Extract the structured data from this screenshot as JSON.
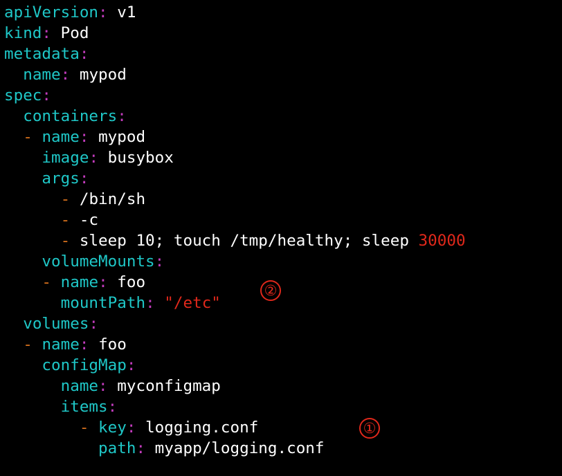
{
  "colors": {
    "background": "#000000",
    "key": "#1fc7c7",
    "punct": "#c23cbd",
    "dash": "#d6701c",
    "value": "#ffffff",
    "number": "#e0281b",
    "string": "#e0281b",
    "marker": "#e0281b"
  },
  "lines": [
    [
      {
        "t": "apiVersion",
        "c": "key"
      },
      {
        "t": ":",
        "c": "punct"
      },
      {
        "t": " v1",
        "c": "value"
      }
    ],
    [
      {
        "t": "kind",
        "c": "key"
      },
      {
        "t": ":",
        "c": "punct"
      },
      {
        "t": " Pod",
        "c": "value"
      }
    ],
    [
      {
        "t": "metadata",
        "c": "key"
      },
      {
        "t": ":",
        "c": "punct"
      }
    ],
    [
      {
        "t": "  "
      },
      {
        "t": "name",
        "c": "key"
      },
      {
        "t": ":",
        "c": "punct"
      },
      {
        "t": " mypod",
        "c": "value"
      }
    ],
    [
      {
        "t": "spec",
        "c": "key"
      },
      {
        "t": ":",
        "c": "punct"
      }
    ],
    [
      {
        "t": "  "
      },
      {
        "t": "containers",
        "c": "key"
      },
      {
        "t": ":",
        "c": "punct"
      }
    ],
    [
      {
        "t": "  "
      },
      {
        "t": "-",
        "c": "dash"
      },
      {
        "t": " "
      },
      {
        "t": "name",
        "c": "key"
      },
      {
        "t": ":",
        "c": "punct"
      },
      {
        "t": " mypod",
        "c": "value"
      }
    ],
    [
      {
        "t": "    "
      },
      {
        "t": "image",
        "c": "key"
      },
      {
        "t": ":",
        "c": "punct"
      },
      {
        "t": " busybox",
        "c": "value"
      }
    ],
    [
      {
        "t": "    "
      },
      {
        "t": "args",
        "c": "key"
      },
      {
        "t": ":",
        "c": "punct"
      }
    ],
    [
      {
        "t": "      "
      },
      {
        "t": "-",
        "c": "dash"
      },
      {
        "t": " /bin/sh",
        "c": "value"
      }
    ],
    [
      {
        "t": "      "
      },
      {
        "t": "-",
        "c": "dash"
      },
      {
        "t": " -c",
        "c": "value"
      }
    ],
    [
      {
        "t": "      "
      },
      {
        "t": "-",
        "c": "dash"
      },
      {
        "t": " sleep 10; touch /tmp/healthy; sleep ",
        "c": "value"
      },
      {
        "t": "30000",
        "c": "number"
      }
    ],
    [
      {
        "t": "    "
      },
      {
        "t": "volumeMounts",
        "c": "key"
      },
      {
        "t": ":",
        "c": "punct"
      }
    ],
    [
      {
        "t": "    "
      },
      {
        "t": "-",
        "c": "dash"
      },
      {
        "t": " "
      },
      {
        "t": "name",
        "c": "key"
      },
      {
        "t": ":",
        "c": "punct"
      },
      {
        "t": " foo",
        "c": "value"
      }
    ],
    [
      {
        "t": "      "
      },
      {
        "t": "mountPath",
        "c": "key"
      },
      {
        "t": ":",
        "c": "punct"
      },
      {
        "t": " "
      },
      {
        "t": "\"/etc\"",
        "c": "string"
      }
    ],
    [
      {
        "t": "  "
      },
      {
        "t": "volumes",
        "c": "key"
      },
      {
        "t": ":",
        "c": "punct"
      }
    ],
    [
      {
        "t": "  "
      },
      {
        "t": "-",
        "c": "dash"
      },
      {
        "t": " "
      },
      {
        "t": "name",
        "c": "key"
      },
      {
        "t": ":",
        "c": "punct"
      },
      {
        "t": " foo",
        "c": "value"
      }
    ],
    [
      {
        "t": "    "
      },
      {
        "t": "configMap",
        "c": "key"
      },
      {
        "t": ":",
        "c": "punct"
      }
    ],
    [
      {
        "t": "      "
      },
      {
        "t": "name",
        "c": "key"
      },
      {
        "t": ":",
        "c": "punct"
      },
      {
        "t": " myconfigmap",
        "c": "value"
      }
    ],
    [
      {
        "t": "      "
      },
      {
        "t": "items",
        "c": "key"
      },
      {
        "t": ":",
        "c": "punct"
      }
    ],
    [
      {
        "t": "        "
      },
      {
        "t": "-",
        "c": "dash"
      },
      {
        "t": " "
      },
      {
        "t": "key",
        "c": "key"
      },
      {
        "t": ":",
        "c": "punct"
      },
      {
        "t": " logging.conf",
        "c": "value"
      }
    ],
    [
      {
        "t": "          "
      },
      {
        "t": "path",
        "c": "key"
      },
      {
        "t": ":",
        "c": "punct"
      },
      {
        "t": " myapp/logging.conf",
        "c": "value"
      }
    ]
  ],
  "annotations": {
    "marker_1": "①",
    "marker_2": "②"
  }
}
